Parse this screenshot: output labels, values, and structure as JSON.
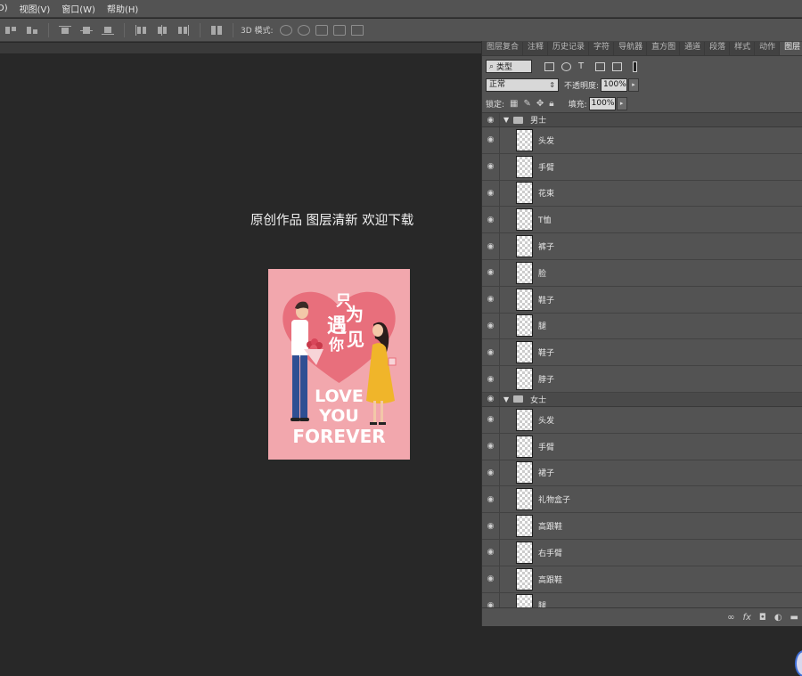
{
  "menu": [
    "D)",
    "视图(V)",
    "窗口(W)",
    "帮助(H)"
  ],
  "options": {
    "mode_label": "3D 模式:"
  },
  "canvas": {
    "headline": "原创作品 图层清新 欢迎下载",
    "poster": {
      "title_lines": [
        "只",
        "遇",
        "为",
        "你",
        "见"
      ],
      "love": "LOVE",
      "you": "YOU",
      "forever": "FOREVER",
      "colors": {
        "bg": "#f2a7ad",
        "heart": "#e86f7c",
        "text": "#ffffff",
        "dress": "#f0b52a",
        "pants": "#2f4f93"
      }
    }
  },
  "panel": {
    "tabs": [
      "图层复合",
      "注释",
      "历史记录",
      "字符",
      "导航器",
      "直方图",
      "通道",
      "段落",
      "样式",
      "动作",
      "图层"
    ],
    "active_tab": "图层",
    "filter_value": "类型",
    "blend_mode": "正常",
    "opacity_label": "不透明度:",
    "opacity_value": "100%",
    "lock_label": "锁定:",
    "fill_label": "填充:",
    "fill_value": "100%",
    "groups": [
      {
        "name": "男士",
        "layers": [
          "头发",
          "手臂",
          "花束",
          "T恤",
          "裤子",
          "脸",
          "鞋子",
          "腿",
          "鞋子",
          "脖子"
        ]
      },
      {
        "name": "女士",
        "layers": [
          "头发",
          "手臂",
          "裙子",
          "礼物盒子",
          "高跟鞋",
          "右手臂",
          "高跟鞋",
          "腿"
        ]
      }
    ],
    "footer_icons": [
      "link-icon",
      "fx-icon",
      "mask-icon",
      "adjustment-icon",
      "folder-icon"
    ]
  }
}
